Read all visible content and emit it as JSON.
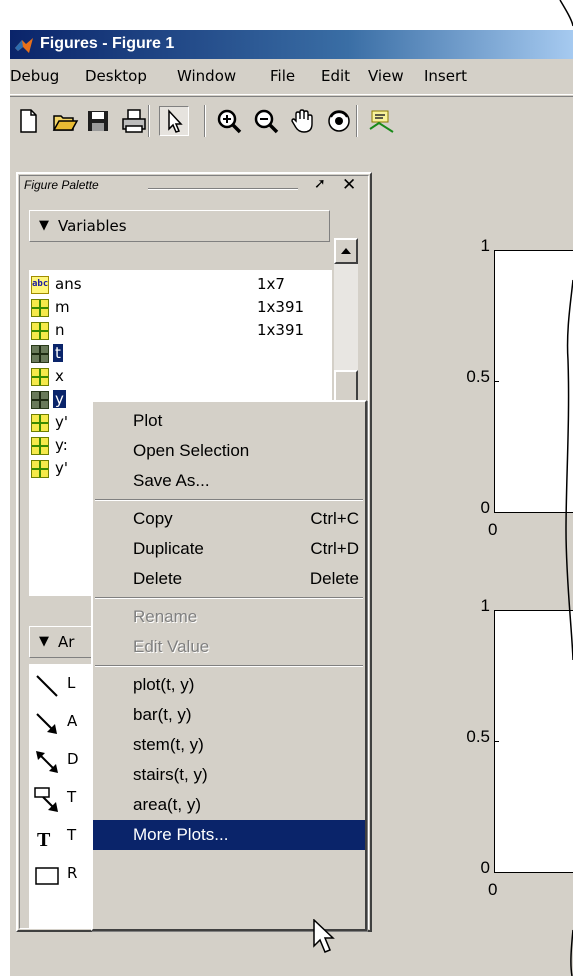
{
  "window": {
    "title": "Figures - Figure 1",
    "icon": "matlab-logo-icon"
  },
  "menu": [
    "Debug",
    "Desktop",
    "Window",
    "File",
    "Edit",
    "View",
    "Insert"
  ],
  "toolbar": [
    {
      "name": "new-figure-icon"
    },
    {
      "name": "open-file-icon"
    },
    {
      "name": "save-icon"
    },
    {
      "name": "print-icon"
    },
    {
      "name": "edit-plot-arrow-icon",
      "pressed": true
    },
    {
      "name": "zoom-in-icon"
    },
    {
      "name": "zoom-out-icon"
    },
    {
      "name": "pan-hand-icon"
    },
    {
      "name": "rotate-3d-icon"
    },
    {
      "name": "data-cursor-icon"
    }
  ],
  "palette": {
    "title": "Figure Palette",
    "undock": "➚",
    "close": "✕",
    "variables_section": "Variables",
    "annotations_section": "Ar",
    "variables": [
      {
        "icon": "abc",
        "name": "ans",
        "size": "1x7"
      },
      {
        "icon": "grid",
        "name": "m",
        "size": "1x391"
      },
      {
        "icon": "grid",
        "name": "n",
        "size": "1x391"
      },
      {
        "icon": "grid-selected",
        "name": "t",
        "size": ""
      },
      {
        "icon": "grid",
        "name": "x",
        "size": ""
      },
      {
        "icon": "grid-selected",
        "name": "y",
        "size": ""
      },
      {
        "icon": "grid",
        "name": "y'",
        "size": ""
      },
      {
        "icon": "grid",
        "name": "y:",
        "size": ""
      },
      {
        "icon": "grid",
        "name": "y'",
        "size": ""
      }
    ],
    "tools": [
      {
        "icon": "line-tool-icon",
        "label": "L"
      },
      {
        "icon": "arrow-tool-icon",
        "label": "A"
      },
      {
        "icon": "double-arrow-tool-icon",
        "label": "D"
      },
      {
        "icon": "text-arrow-tool-icon",
        "label": "T"
      },
      {
        "icon": "text-box-tool-icon",
        "label": "T",
        "glyph": "T"
      },
      {
        "icon": "rectangle-tool-icon",
        "label": "R"
      }
    ]
  },
  "plots": [
    {
      "y_ticks": [
        "1",
        "0.5",
        "0"
      ],
      "x_tick": "0"
    },
    {
      "y_ticks": [
        "1",
        "0.5",
        "0"
      ],
      "x_tick": "0"
    }
  ],
  "context_menu": {
    "items": [
      {
        "label": "Plot",
        "shortcut": "",
        "disabled": false
      },
      {
        "label": "Open Selection",
        "shortcut": "",
        "disabled": false
      },
      {
        "label": "Save As...",
        "shortcut": "",
        "disabled": false
      },
      {
        "separator": true
      },
      {
        "label": "Copy",
        "shortcut": "Ctrl+C",
        "disabled": false
      },
      {
        "label": "Duplicate",
        "shortcut": "Ctrl+D",
        "disabled": false
      },
      {
        "label": "Delete",
        "shortcut": "Delete",
        "disabled": false
      },
      {
        "separator": true
      },
      {
        "label": "Rename",
        "shortcut": "",
        "disabled": true
      },
      {
        "label": "Edit Value",
        "shortcut": "",
        "disabled": true
      },
      {
        "separator": true
      },
      {
        "label": "plot(t, y)",
        "shortcut": "",
        "disabled": false
      },
      {
        "label": "bar(t, y)",
        "shortcut": "",
        "disabled": false
      },
      {
        "label": "stem(t, y)",
        "shortcut": "",
        "disabled": false
      },
      {
        "label": "stairs(t, y)",
        "shortcut": "",
        "disabled": false
      },
      {
        "label": "area(t, y)",
        "shortcut": "",
        "disabled": false
      },
      {
        "label": "More Plots...",
        "shortcut": "",
        "disabled": false,
        "highlighted": true
      }
    ]
  },
  "colors": {
    "title_bar_start": "#0a246a",
    "title_bar_end": "#a6caf0",
    "selection": "#0a246a",
    "chrome": "#d4d0c8"
  }
}
